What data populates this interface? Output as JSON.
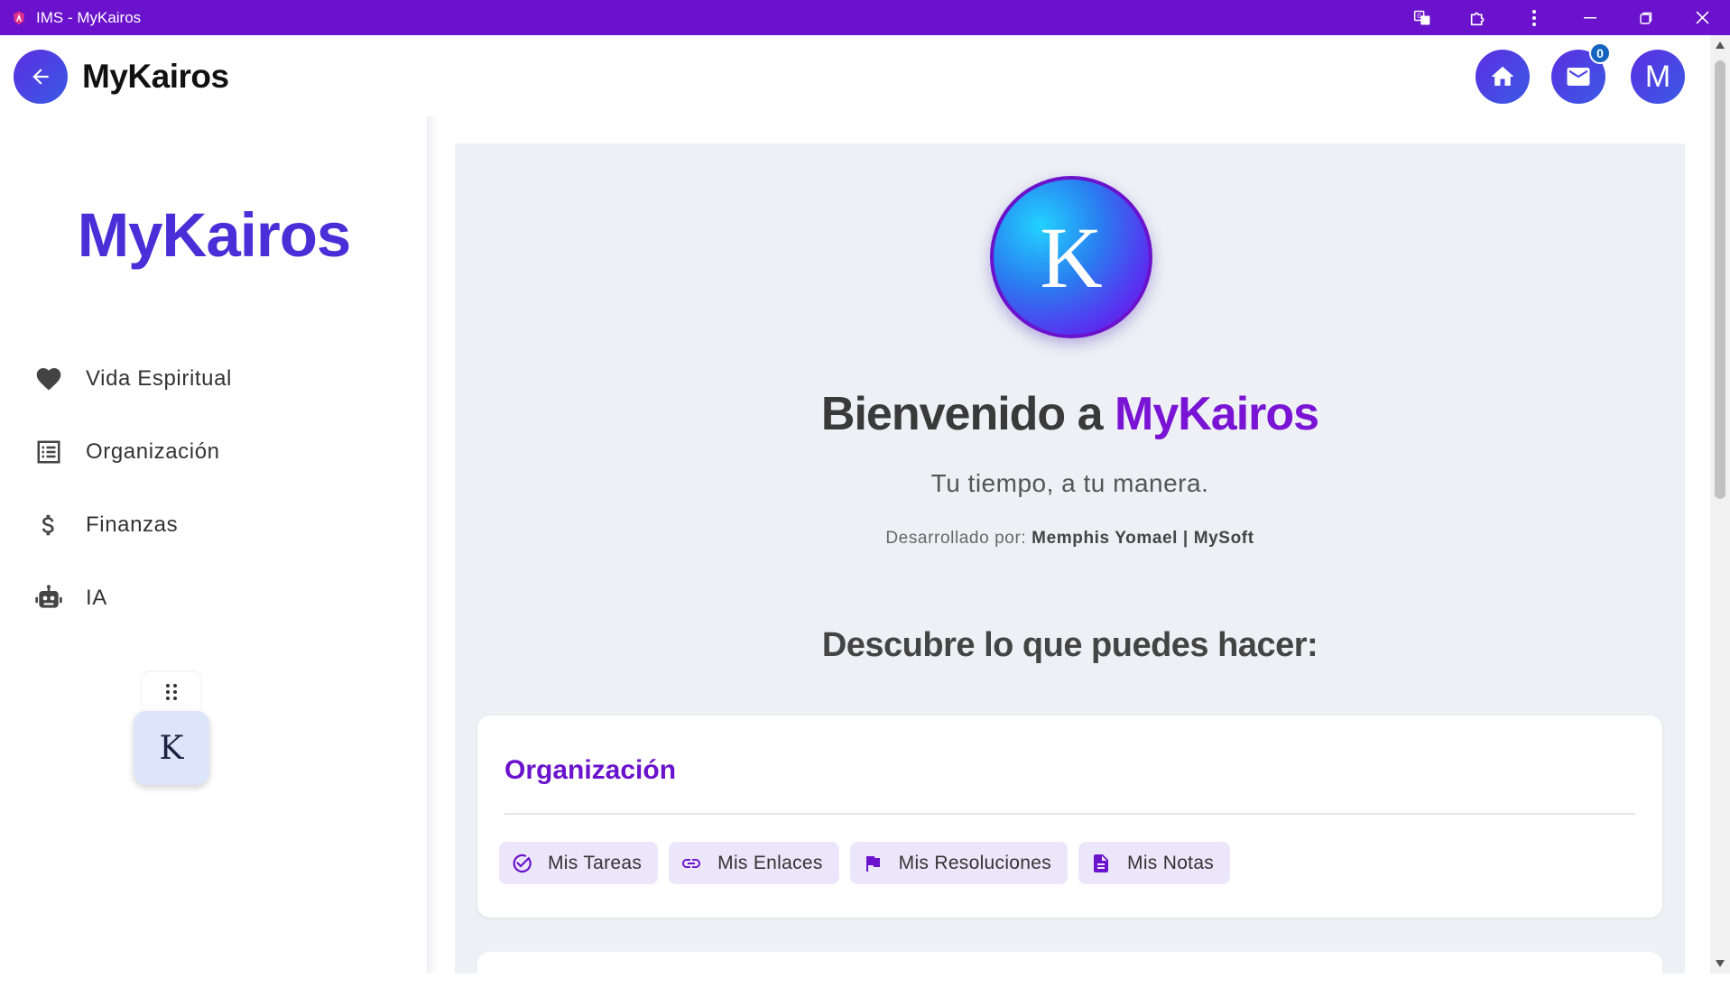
{
  "window": {
    "title": "IMS - MyKairos"
  },
  "header": {
    "brand": "MyKairos",
    "mail_count": "0",
    "avatar_initial": "M"
  },
  "sidebar": {
    "brand": "MyKairos",
    "items": [
      {
        "label": "Vida Espiritual",
        "icon": "heart-icon"
      },
      {
        "label": "Organización",
        "icon": "list-icon"
      },
      {
        "label": "Finanzas",
        "icon": "dollar-icon"
      },
      {
        "label": "IA",
        "icon": "robot-icon"
      }
    ],
    "fab_letter": "K"
  },
  "main": {
    "logo_letter": "K",
    "welcome_prefix": "Bienvenido a ",
    "welcome_accent": "MyKairos",
    "tagline": "Tu tiempo, a tu manera.",
    "dev_prefix": "Desarrollado por: ",
    "dev_name": "Memphis Yomael | MySoft",
    "discover": "Descubre lo que puedes hacer:",
    "card": {
      "title": "Organización",
      "chips": [
        {
          "label": "Mis Tareas",
          "icon": "check-circle-icon"
        },
        {
          "label": "Mis Enlaces",
          "icon": "link-icon"
        },
        {
          "label": "Mis Resoluciones",
          "icon": "flag-icon"
        },
        {
          "label": "Mis Notas",
          "icon": "note-icon"
        }
      ]
    }
  },
  "colors": {
    "titlebar": "#6a12cc",
    "accent": "#7a14d4",
    "brand_blue": "#4a2ed8",
    "chip_bg": "#ece6fb",
    "main_bg": "#eef0f5"
  }
}
